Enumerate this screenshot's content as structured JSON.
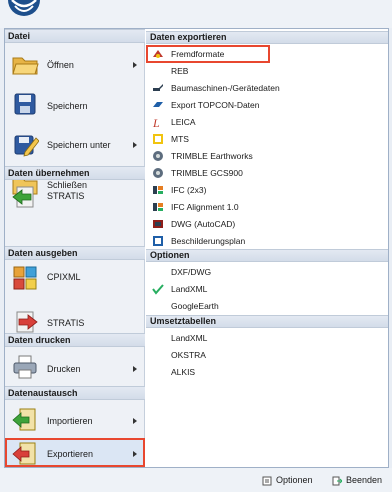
{
  "left": {
    "sections": {
      "datei": "Datei",
      "uebernehmen": "Daten übernehmen",
      "ausgeben": "Daten ausgeben",
      "drucken": "Daten drucken",
      "austausch": "Datenaustausch"
    },
    "items": {
      "oeffnen": "Öffnen",
      "speichern": "Speichern",
      "speichern_unter": "Speichern unter",
      "schliessen": "Schließen",
      "stratis_in": "STRATIS",
      "cpixml": "CPIXML",
      "stratis_out": "STRATIS",
      "drucken": "Drucken",
      "importieren": "Importieren",
      "exportieren": "Exportieren"
    }
  },
  "right": {
    "sections": {
      "export": "Daten exportieren",
      "optionen": "Optionen",
      "umsetz": "Umsetztabellen"
    },
    "export_items": [
      "Fremdformate",
      "REB",
      "Baumaschinen-/Gerätedaten",
      "Export TOPCON-Daten",
      "LEICA",
      "MTS",
      "TRIMBLE Earthworks",
      "TRIMBLE GCS900",
      "IFC (2x3)",
      "IFC Alignment 1.0",
      "DWG (AutoCAD)",
      "Beschilderungsplan"
    ],
    "optionen_items": [
      "DXF/DWG",
      "LandXML",
      "GoogleEarth"
    ],
    "umsetz_items": [
      "LandXML",
      "OKSTRA",
      "ALKIS"
    ]
  },
  "bottom": {
    "optionen": "Optionen",
    "beenden": "Beenden"
  },
  "colors": {
    "highlight": "#e8472f",
    "accent": "#1f5fa8"
  }
}
